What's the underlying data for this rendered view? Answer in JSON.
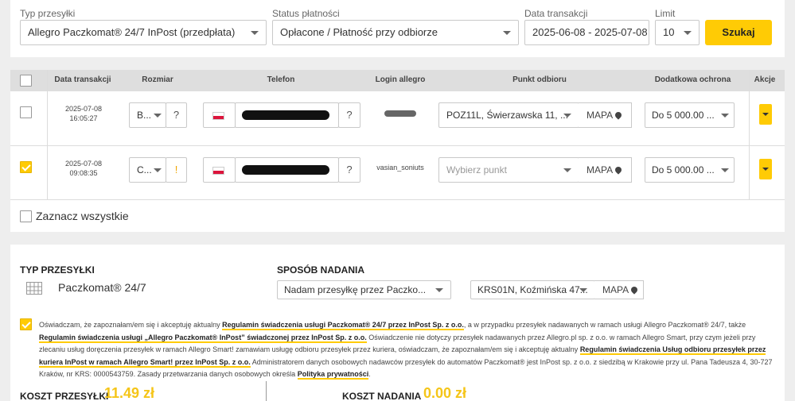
{
  "filters": {
    "type_label": "Typ przesyłki",
    "type_value": "Allegro Paczkomat® 24/7 InPost (przedpłata)",
    "payment_label": "Status płatności",
    "payment_value": "Opłacone / Płatność przy odbiorze",
    "date_label": "Data transakcji",
    "date_value": "2025-06-08 - 2025-07-08",
    "limit_label": "Limit",
    "limit_value": "10",
    "search_label": "Szukaj"
  },
  "table": {
    "headers": [
      "Data transakcji",
      "Rozmiar",
      "Telefon",
      "Login allegro",
      "Punkt odbioru",
      "Dodatkowa ochrona",
      "Akcje"
    ],
    "rows": [
      {
        "date": "2025-07-08",
        "time": "16:05:27",
        "size": "B...",
        "size_hint": "?",
        "phone_hint": "?",
        "login": "",
        "pickup": "POZ11L, Świerzawska 11, ...",
        "pickup_placeholder": "",
        "map": "MAPA",
        "protection": "Do 5 000.00 ...",
        "checked": false
      },
      {
        "date": "2025-07-08",
        "time": "09:08:35",
        "size": "C...",
        "size_hint": "!",
        "phone_hint": "?",
        "login": "vasian_soniuts",
        "pickup": "",
        "pickup_placeholder": "Wybierz punkt",
        "map": "MAPA",
        "protection": "Do 5 000.00 ...",
        "checked": true
      }
    ],
    "select_all_label": "Zaznacz wszystkie"
  },
  "shipment": {
    "type_title": "TYP PRZESYŁKI",
    "type_value": "Paczkomat® 24/7",
    "method_title": "SPOSÓB NADANIA",
    "method_value": "Nadam przesyłkę przez Paczko...",
    "point_value": "KRS01N, Koźmińska 47...",
    "map": "MAPA"
  },
  "consent": {
    "t1": "Oświadczam, że zapoznałam/em się i akceptuję aktualny ",
    "l1": "Regulamin świadczenia usługi Paczkomat® 24/7 przez InPost Sp. z o.o.",
    "t2": ", a w przypadku przesyłek nadawanych w ramach usługi Allegro Paczkomat® 24/7, także ",
    "l2": "Regulamin świadczenia usługi „Allegro Paczkomat® InPost” świadczonej przez InPost Sp. z o.o.",
    "t3": " Oświadczenie nie dotyczy przesyłek nadawanych przez Allegro.pl sp. z o.o. w ramach Allegro Smart, przy czym jeżeli przy zlecaniu usług doręczenia przesyłek w ramach Allegro Smart! zamawiam usługę odbioru przesyłek przez kuriera, oświadczam, że zapoznałam/em się i akceptuję aktualny ",
    "l3": "Regulamin świadczenia Usług odbioru przesyłek przez kuriera InPost w ramach Allegro Smart! przez InPost Sp. z o.o.",
    "t4": " Administratorem danych osobowych nadawców przesyłek do automatów Paczkomat® jest InPost sp. z o.o. z siedzibą w Krakowie przy ul. Pana Tadeusza 4, 30-727 Kraków, nr KRS: 0000543759. Zasady przetwarzania danych osobowych określa ",
    "l4": "Polityka prywatności",
    "t5": "."
  },
  "costs": {
    "shipping_label": "KOSZT PRZESYŁKI",
    "shipping_value": "11.49 zł",
    "sending_label": "KOSZT NADANIA",
    "sending_value": "0.00 zł"
  },
  "colors": {
    "accent": "#ffcb05",
    "price": "#f5c518",
    "flag_red": "#dc143c"
  }
}
